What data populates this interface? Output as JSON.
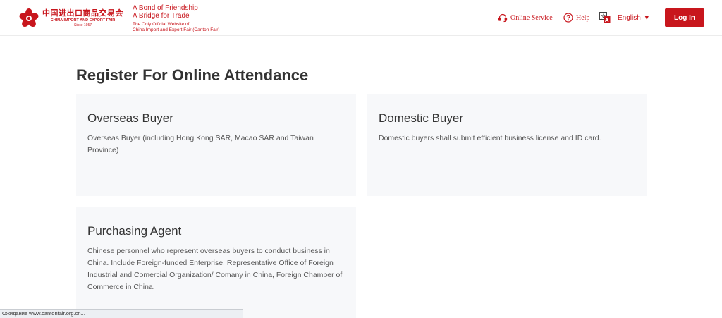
{
  "header": {
    "logo": {
      "cn_text": "中国进出口商品交易会",
      "en_text": "CHINA IMPORT AND EXPORT FAIR",
      "since": "Since 1957"
    },
    "tagline": {
      "line1": "A Bond of Friendship",
      "line2": "A Bridge for Trade",
      "sub1": "The Only Official Website of",
      "sub2": "China Import and Export Fair (Canton Fair)"
    },
    "nav": {
      "online_service": "Online Service",
      "help": "Help",
      "language": "English"
    },
    "login_label": "Log In"
  },
  "main": {
    "title": "Register For Online Attendance",
    "cards": [
      {
        "title": "Overseas Buyer",
        "desc": "Overseas Buyer (including Hong Kong SAR, Macao SAR and Taiwan Province)"
      },
      {
        "title": "Domestic Buyer",
        "desc": "Domestic buyers shall submit efficient business license and ID card."
      },
      {
        "title": "Purchasing Agent",
        "desc": "Chinese personnel who represent overseas buyers to conduct business in China. Include Foreign-funded Enterprise, Representative Office of Foreign Industrial and Comercial Organization/ Comany in China, Foreign Chamber of Commerce in China."
      }
    ]
  },
  "statusbar": {
    "text": "Ожидание www.cantonfair.org.cn..."
  },
  "colors": {
    "brand_red": "#c8161d",
    "card_bg": "#f7f8fa"
  },
  "icons": {
    "online_service": "headset-icon",
    "help": "question-circle-icon",
    "language": "translate-icon",
    "language_chevron": "caret-down-icon",
    "logo": "canton-fair-flower-icon"
  }
}
